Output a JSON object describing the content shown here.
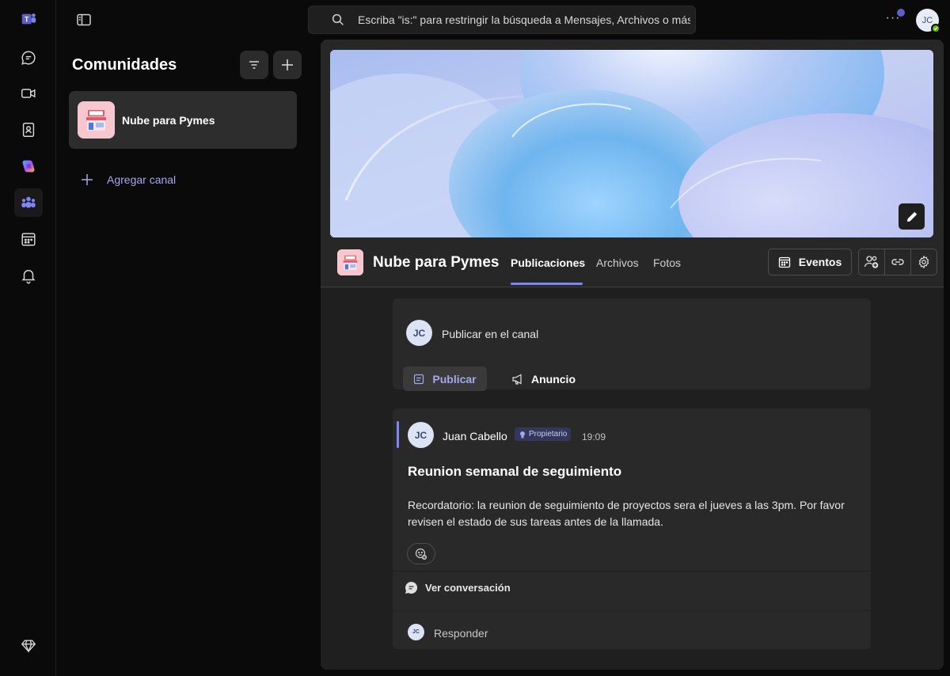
{
  "app": {
    "accent": "#7f85f5",
    "brand": "#5b5fc7"
  },
  "rail": {
    "items": [
      {
        "icon": "teams-logo-icon"
      },
      {
        "icon": "chat-icon"
      },
      {
        "icon": "video-icon"
      },
      {
        "icon": "contacts-icon"
      },
      {
        "icon": "copilot-icon"
      },
      {
        "icon": "communities-icon"
      },
      {
        "icon": "calendar-icon"
      },
      {
        "icon": "bell-icon"
      },
      {
        "icon": "diamond-icon"
      }
    ]
  },
  "topbar": {
    "search_placeholder": "Escriba \"is:\" para restringir la búsqueda a Mensajes, Archivos o más",
    "more_label": "···",
    "user_initials": "JC"
  },
  "sidebar": {
    "title": "Comunidades",
    "community": {
      "name": "Nube para Pymes"
    },
    "add_channel_label": "Agregar canal"
  },
  "header": {
    "title": "Nube para Pymes",
    "tabs": [
      {
        "label": "Publicaciones",
        "active": true
      },
      {
        "label": "Archivos",
        "active": false
      },
      {
        "label": "Fotos",
        "active": false
      }
    ],
    "events_label": "Eventos"
  },
  "compose": {
    "initials": "JC",
    "label": "Publicar en el canal",
    "post_label": "Publicar",
    "announce_label": "Anuncio"
  },
  "post": {
    "initials": "JC",
    "author": "Juan Cabello",
    "role": "Propietario",
    "time": "19:09",
    "title": "Reunion semanal de seguimiento",
    "body": "Recordatorio: la reunion de seguimiento de proyectos sera el jueves a las 3pm. Por favor revisen el estado de sus tareas antes de la llamada.",
    "view_conversation_label": "Ver conversación",
    "reply_initials": "JC",
    "reply_label": "Responder"
  }
}
